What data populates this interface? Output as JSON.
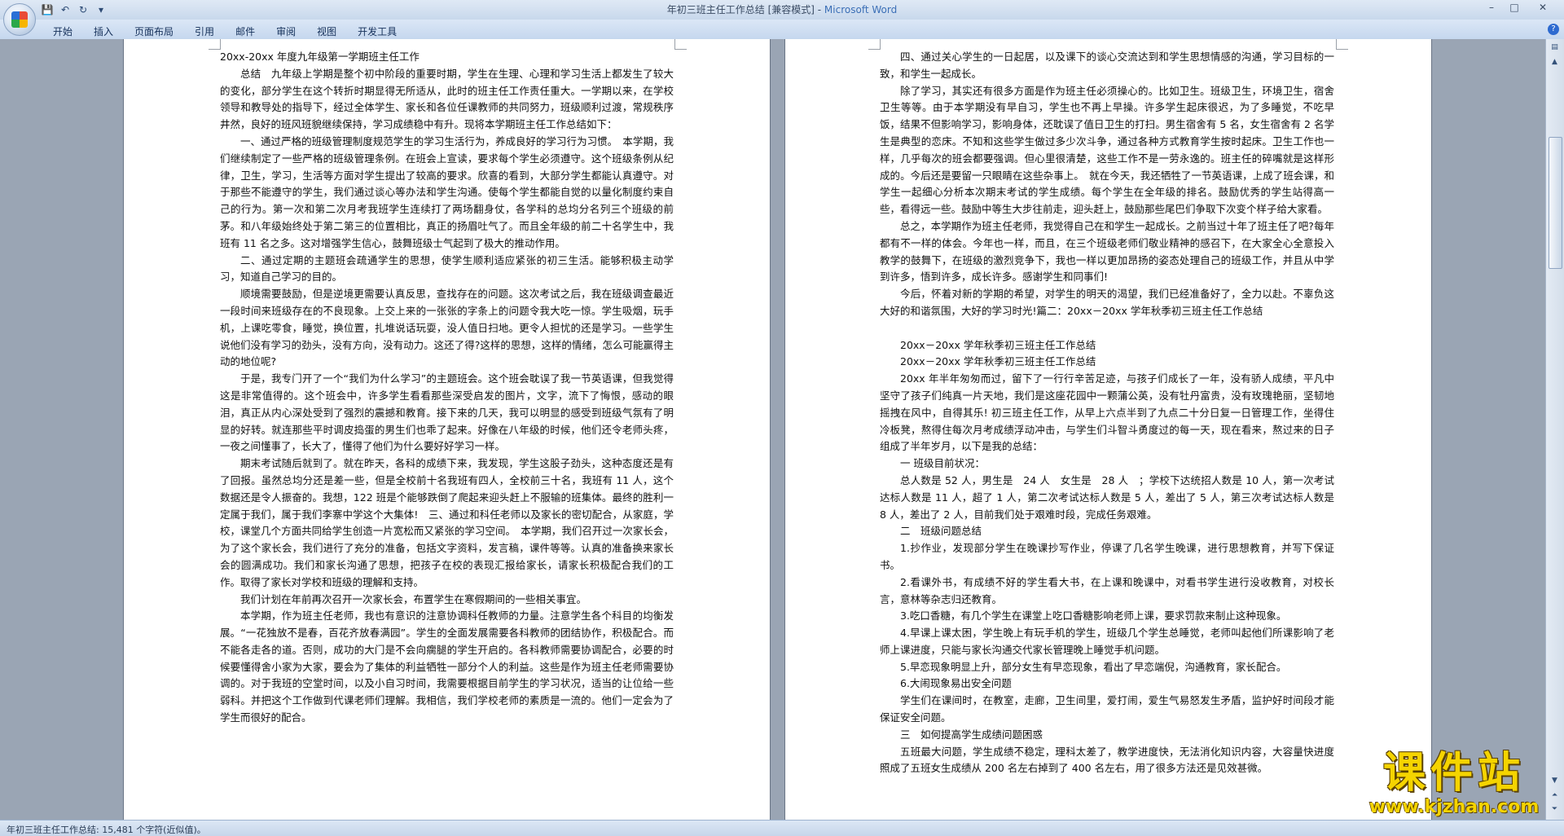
{
  "window": {
    "title": "年初三班主任工作总结 [兼容模式] - ",
    "app_name": "Microsoft Word",
    "qat": {
      "save": "💾",
      "undo": "↶",
      "redo": "↻",
      "more": "▾"
    },
    "controls": {
      "minimize": "–",
      "maximize": "□",
      "close": "✕"
    }
  },
  "ribbon": {
    "tabs": [
      "开始",
      "插入",
      "页面布局",
      "引用",
      "邮件",
      "审阅",
      "视图",
      "开发工具"
    ],
    "help": "?"
  },
  "page1": {
    "paragraphs": [
      {
        "text": "20xx-20xx 年度九年级第一学期班主任工作",
        "indent": false
      },
      {
        "text": "总结　九年级上学期是整个初中阶段的重要时期，学生在生理、心理和学习生活上都发生了较大的变化，部分学生在这个转折时期显得无所适从，此时的班主任工作责任重大。一学期以来，在学校领导和教导处的指导下，经过全体学生、家长和各位任课教师的共同努力，班级顺利过渡，常规秩序井然，良好的班风班貌继续保持，学习成绩稳中有升。现将本学期班主任工作总结如下：",
        "indent": true
      },
      {
        "text": "一、通过严格的班级管理制度规范学生的学习生活行为，养成良好的学习行为习惯。　本学期，我们继续制定了一些严格的班级管理条例。在班会上宣读，要求每个学生必须遵守。这个班级条例从纪律，卫生，学习，生活等方面对学生提出了较高的要求。欣喜的看到，大部分学生都能认真遵守。对于那些不能遵守的学生，我们通过谈心等办法和学生沟通。使每个学生都能自觉的以量化制度约束自己的行为。第一次和第二次月考我班学生连续打了两场翻身仗，各学科的总均分名列三个班级的前茅。和八年级始终处于第二第三的位置相比，真正的扬眉吐气了。而且全年级的前二十名学生中，我班有 11 名之多。这对增强学生信心，鼓舞班级士气起到了极大的推动作用。",
        "indent": true
      },
      {
        "text": "二、通过定期的主题班会疏通学生的思想，使学生顺利适应紧张的初三生活。能够积极主动学习，知道自己学习的目的。",
        "indent": true
      },
      {
        "text": "顺境需要鼓励，但是逆境更需要认真反思，查找存在的问题。这次考试之后，我在班级调查最近一段时间来班级存在的不良现象。上交上来的一张张的字条上的问题令我大吃一惊。学生吸烟，玩手机，上课吃零食，睡觉，换位置，扎堆说话玩耍，没人值日扫地。更令人担忧的还是学习。一些学生说他们没有学习的劲头，没有方向，没有动力。这还了得?这样的思想，这样的情绪，怎么可能赢得主动的地位呢?",
        "indent": true
      },
      {
        "text": "于是，我专门开了一个“我们为什么学习”的主题班会。这个班会耽误了我一节英语课，但我觉得这是非常值得的。这个班会中，许多学生看看那些深受启发的图片，文字，流下了悔恨，感动的眼泪，真正从内心深处受到了强烈的震撼和教育。接下来的几天，我可以明显的感受到班级气氛有了明显的好转。就连那些平时调皮捣蛋的男生们也乖了起来。好像在八年级的时候，他们还令老师头疼，一夜之间懂事了，长大了，懂得了他们为什么要好好学习一样。",
        "indent": true
      },
      {
        "text": "期末考试随后就到了。就在昨天，各科的成绩下来，我发现，学生这股子劲头，这种态度还是有了回报。虽然总均分还是差一些，但是全校前十名我班有四人，全校前三十名，我班有 11 人，这个数据还是令人振奋的。我想，122 班是个能够跌倒了爬起来迎头赶上不服输的班集体。最终的胜利一定属于我们，属于我们李寨中学这个大集体!　三、通过和科任老师以及家长的密切配合，从家庭，学校，课堂几个方面共同给学生创造一片宽松而又紧张的学习空间。　本学期，我们召开过一次家长会，为了这个家长会，我们进行了充分的准备，包括文字资料，发言稿，课件等等。认真的准备换来家长会的圆满成功。我们和家长沟通了思想，把孩子在校的表现汇报给家长，请家长积极配合我们的工作。取得了家长对学校和班级的理解和支持。",
        "indent": true
      },
      {
        "text": "我们计划在年前再次召开一次家长会，布置学生在寒假期间的一些相关事宜。",
        "indent": true
      },
      {
        "text": "本学期，作为班主任老师，我也有意识的注意协调科任教师的力量。注意学生各个科目的均衡发展。“一花独放不是春，百花齐放春满园”。学生的全面发展需要各科教师的团结协作，积极配合。而不能各走各的道。否则，成功的大门是不会向瘸腿的学生开启的。各科教师需要协调配合，必要的时候要懂得舍小家为大家，要会为了集体的利益牺牲一部分个人的利益。这些是作为班主任老师需要协调的。对于我班的空堂时间，以及小自习时间，我需要根据目前学生的学习状况，适当的让位给一些弱科。并把这个工作做到代课老师们理解。我相信，我们学校老师的素质是一流的。他们一定会为了学生而很好的配合。",
        "indent": true
      }
    ]
  },
  "page2": {
    "paragraphs": [
      {
        "text": "四、通过关心学生的一日起居，以及课下的谈心交流达到和学生思想情感的沟通，学习目标的一致，和学生一起成长。",
        "indent": true
      },
      {
        "text": "除了学习，其实还有很多方面是作为班主任必须操心的。比如卫生。班级卫生，环境卫生，宿舍卫生等等。由于本学期没有早自习，学生也不再上早操。许多学生起床很迟，为了多睡觉，不吃早饭，结果不但影响学习，影响身体，还耽误了值日卫生的打扫。男生宿舍有 5 名，女生宿舍有 2 名学生是典型的恋床。不知和这些学生做过多少次斗争，通过各种方式教育学生按时起床。卫生工作也一样，几乎每次的班会都要强调。但心里很清楚，这些工作不是一劳永逸的。班主任的碎嘴就是这样形成的。今后还是要留一只眼睛在这些杂事上。　就在今天，我还牺牲了一节英语课，上成了班会课，和学生一起细心分析本次期末考试的学生成绩。每个学生在全年级的排名。鼓励优秀的学生站得高一些，看得远一些。鼓励中等生大步往前走，迎头赶上，鼓励那些尾巴们争取下次变个样子给大家看。",
        "indent": true
      },
      {
        "text": "总之，本学期作为班主任老师，我觉得自己在和学生一起成长。之前当过十年了班主任了吧?每年都有不一样的体会。今年也一样，而且，在三个班级老师们敬业精神的感召下，在大家全心全意投入教学的鼓舞下，在班级的激烈竞争下，我也一样以更加昂扬的姿态处理自己的班级工作，并且从中学到许多，悟到许多，成长许多。感谢学生和同事们!",
        "indent": true
      },
      {
        "text": "今后，怀着对新的学期的希望，对学生的明天的渴望，我们已经准备好了，全力以赴。不辜负这大好的和谐氛围，大好的学习时光!篇二：20xx－20xx 学年秋季初三班主任工作总结",
        "indent": true
      },
      {
        "text": "",
        "indent": false
      },
      {
        "text": "20xx－20xx 学年秋季初三班主任工作总结",
        "indent": true
      },
      {
        "text": "20xx－20xx 学年秋季初三班主任工作总结",
        "indent": true
      },
      {
        "text": "20xx 年半年匆匆而过，留下了一行行辛苦足迹，与孩子们成长了一年，没有骄人成绩，平凡中坚守了孩子们纯真一片天地，我们是这座花园中一颗蒲公英，没有牡丹富贵，没有玫瑰艳丽，坚韧地摇拽在风中，自得其乐! 初三班主任工作，从早上六点半到了九点二十分日复一日管理工作，坐得住冷板凳，熬得住每次月考成绩浮动冲击，与学生们斗智斗勇度过的每一天，现在看来，熬过来的日子组成了半年岁月，以下是我的总结：",
        "indent": true
      },
      {
        "text": "一  班级目前状况：",
        "indent": true
      },
      {
        "text": "总人数是 52 人，男生是　24 人　女生是　28 人　；学校下达统招人数是 10 人，第一次考试达标人数是 11 人，超了 1 人，第二次考试达标人数是 5 人，差出了 5 人，第三次考试达标人数是 8 人，差出了 2 人，目前我们处于艰难时段，完成任务艰难。",
        "indent": true
      },
      {
        "text": "二　班级问题总结",
        "indent": true
      },
      {
        "text": "1.抄作业，发现部分学生在晚课抄写作业，停课了几名学生晚课，进行思想教育，并写下保证书。",
        "indent": true
      },
      {
        "text": "2.看课外书，有成绩不好的学生看大书，在上课和晚课中，对看书学生进行没收教育，对校长言，意林等杂志归还教育。",
        "indent": true
      },
      {
        "text": "3.吃口香糖，有几个学生在课堂上吃口香糖影响老师上课，要求罚款来制止这种现象。",
        "indent": true
      },
      {
        "text": "4.早课上课太困，学生晚上有玩手机的学生，班级几个学生总睡觉，老师叫起他们所课影响了老师上课进度，只能与家长沟通交代家长管理晚上睡觉手机问题。",
        "indent": true
      },
      {
        "text": "5.早恋现象明显上升，部分女生有早恋现象，看出了早恋端倪，沟通教育，家长配合。",
        "indent": true
      },
      {
        "text": "6.大闹现象易出安全问题",
        "indent": true
      },
      {
        "text": "学生们在课间时，在教室，走廊，卫生间里，爱打闹，爱生气易怒发生矛盾，监护好时间段才能保证安全问题。",
        "indent": true
      },
      {
        "text": "三　如何提高学生成绩问题困惑",
        "indent": true
      },
      {
        "text": "五班最大问题，学生成绩不稳定，理科太差了，教学进度快，无法消化知识内容，大容量快进度照成了五班女生成绩从 200 名左右掉到了 400 名左右，用了很多方法还是见效甚微。",
        "indent": true
      }
    ]
  },
  "statusbar": {
    "text": "年初三班主任工作总结: 15,481 个字符(近似值)。"
  },
  "watermark": {
    "title": "课件站",
    "url": "www.kjzhan.com"
  }
}
